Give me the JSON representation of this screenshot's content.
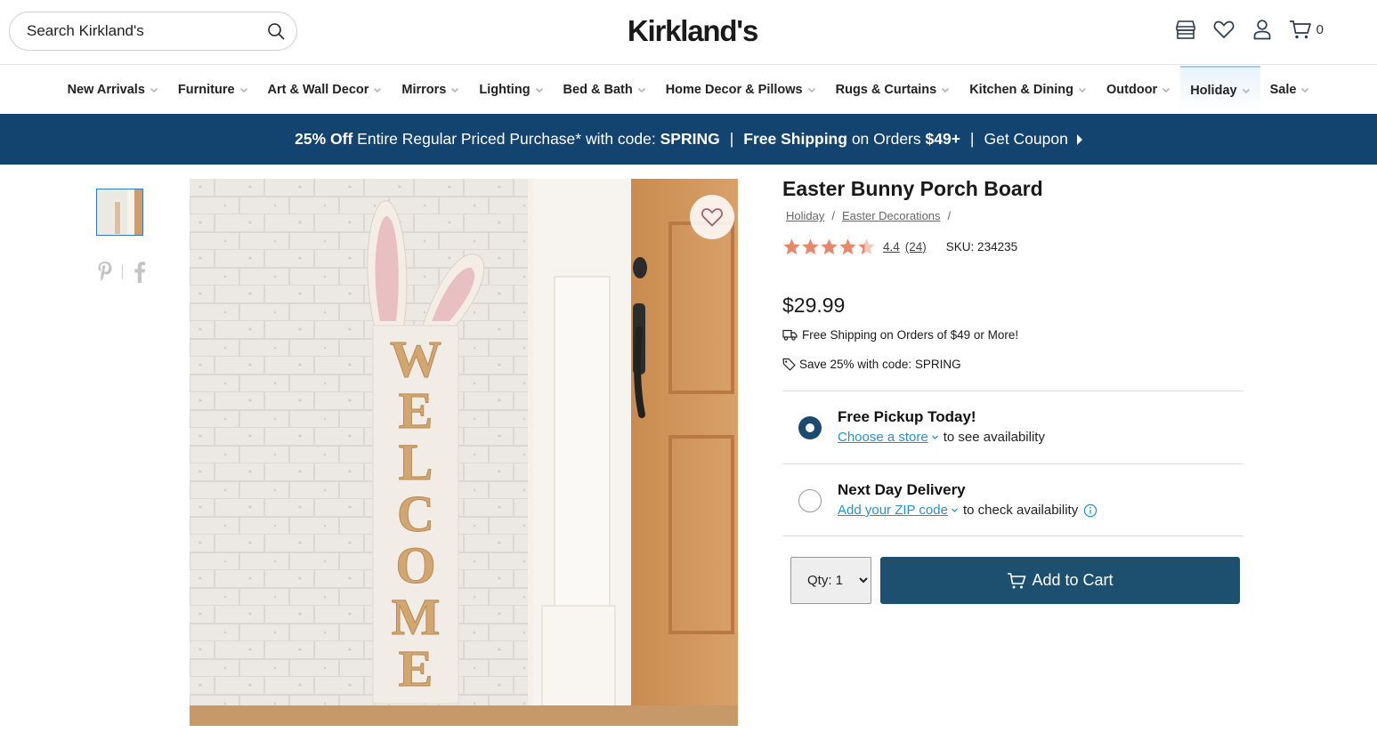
{
  "header": {
    "search_placeholder": "Search Kirkland's",
    "logo": "Kirkland's",
    "cart_count": "0"
  },
  "nav": {
    "items": [
      {
        "label": "New Arrivals"
      },
      {
        "label": "Furniture"
      },
      {
        "label": "Art & Wall Decor"
      },
      {
        "label": "Mirrors"
      },
      {
        "label": "Lighting"
      },
      {
        "label": "Bed & Bath"
      },
      {
        "label": "Home Decor & Pillows"
      },
      {
        "label": "Rugs & Curtains"
      },
      {
        "label": "Kitchen & Dining"
      },
      {
        "label": "Outdoor"
      },
      {
        "label": "Holiday"
      },
      {
        "label": "Sale"
      }
    ],
    "active": "Holiday"
  },
  "promo": {
    "p1_bold": "25% Off",
    "p1_text": " Entire Regular Priced Purchase* with code: ",
    "p1_code": "SPRING",
    "sep": "|",
    "p2_bold": "Free Shipping",
    "p2_text": " on Orders ",
    "p2_amount": "$49+",
    "coupon": "Get Coupon"
  },
  "product": {
    "title": "Easter Bunny Porch Board",
    "breadcrumbs": [
      "Holiday",
      "Easter Decorations"
    ],
    "crumb_sep": "/",
    "rating": "4.4",
    "rating_value": 4.4,
    "reviews": "(24)",
    "sku": "SKU: 234235",
    "price": "$29.99",
    "shipping_note": "Free Shipping on Orders of $49 or More!",
    "promo_note": "Save 25% with code: SPRING",
    "image_letters": [
      "W",
      "E",
      "L",
      "C",
      "O",
      "M",
      "E"
    ]
  },
  "fulfillment": {
    "pickup": {
      "title": "Free Pickup Today!",
      "link": "Choose a store",
      "rest": "to see availability",
      "selected": true
    },
    "delivery": {
      "title": "Next Day Delivery",
      "link": "Add your ZIP code",
      "rest": "to check availability",
      "selected": false
    }
  },
  "purchase": {
    "qty_label": "Qty: 1",
    "add_to_cart": "Add to Cart"
  },
  "colors": {
    "promo_bg": "#13436f",
    "button_bg": "#1d4f6f",
    "link": "#2b8fc7",
    "star": "#e8876a"
  }
}
